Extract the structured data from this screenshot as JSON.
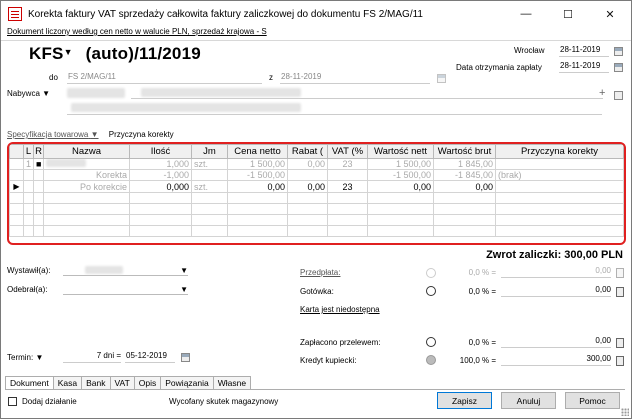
{
  "window": {
    "title": "Korekta faktury VAT sprzedaży całkowita faktury zaliczkowej do dokumentu FS 2/MAG/11",
    "minimize": "—",
    "maximize": "☐",
    "close": "✕"
  },
  "subheader": "Dokument liczony według cen netto w walucie PLN, sprzedaż krajowa - S",
  "document": {
    "number_prefix": "KFS",
    "number_suffix": "(auto)/11/2019",
    "place_label": "Wrocław",
    "issue_date": "28-11-2019",
    "payment_date_label": "Data otrzymania zapłaty",
    "payment_date": "28-11-2019",
    "do_label": "do",
    "do_value": "FS 2/MAG/11",
    "z_label": "z",
    "z_value": "28-11-2019",
    "buyer_label": "Nabywca"
  },
  "spec_tabs": {
    "tab1": "Specyfikacja towarowa",
    "tab2": "Przyczyna korekty"
  },
  "grid": {
    "columns": [
      "L",
      "R",
      "Nazwa",
      "Ilość",
      "Jm",
      "Cena netto",
      "Rabat (",
      "VAT (%",
      "Wartość nett",
      "Wartość brut",
      "Przyczyna korekty"
    ],
    "rows": [
      {
        "l": "1",
        "r": "■",
        "nazwa": "",
        "ilosc": "1,000",
        "jm": "szt.",
        "cena": "1 500,00",
        "rabat": "0,00",
        "vat": "23",
        "netto": "1 500,00",
        "brutto": "1 845,00",
        "przyczyna": ""
      },
      {
        "l": "",
        "r": "",
        "nazwa": "Korekta",
        "ilosc": "-1,000",
        "jm": "",
        "cena": "-1 500,00",
        "rabat": "",
        "vat": "",
        "netto": "-1 500,00",
        "brutto": "-1 845,00",
        "przyczyna": "(brak)"
      },
      {
        "l": "",
        "r": "",
        "nazwa": "Po korekcie",
        "ilosc": "0,000",
        "jm": "szt.",
        "cena": "0,00",
        "rabat": "0,00",
        "vat": "23",
        "netto": "0,00",
        "brutto": "0,00",
        "przyczyna": ""
      }
    ]
  },
  "summary": {
    "zwrot": "Zwrot zaliczki: 300,00 PLN"
  },
  "people": {
    "wystawil_label": "Wystawił(a):",
    "odebral_label": "Odebrał(a):"
  },
  "payments": {
    "przedplata_label": "Przedpłata:",
    "przedplata_pct": "0,0 % =",
    "przedplata_value": "0,00",
    "gotowka_label": "Gotówka:",
    "gotowka_pct": "0,0 % =",
    "gotowka_value": "0,00",
    "karta_label": "Karta jest niedostępna",
    "przelew_label": "Zapłacono przelewem:",
    "przelew_pct": "0,0 % =",
    "przelew_value": "0,00",
    "kredyt_label": "Kredyt kupiecki:",
    "kredyt_pct": "100,0 % =",
    "kredyt_value": "300,00"
  },
  "termin": {
    "label": "Termin:",
    "days": "7 dni =",
    "date": "05-12-2019"
  },
  "bottom_tabs": [
    "Dokument",
    "Kasa",
    "Bank",
    "VAT",
    "Opis",
    "Powiązania",
    "Własne"
  ],
  "footer": {
    "checkbox_label": "Dodaj działanie",
    "status": "Wycofany skutek magazynowy",
    "save": "Zapisz",
    "cancel": "Anuluj",
    "help": "Pomoc"
  }
}
